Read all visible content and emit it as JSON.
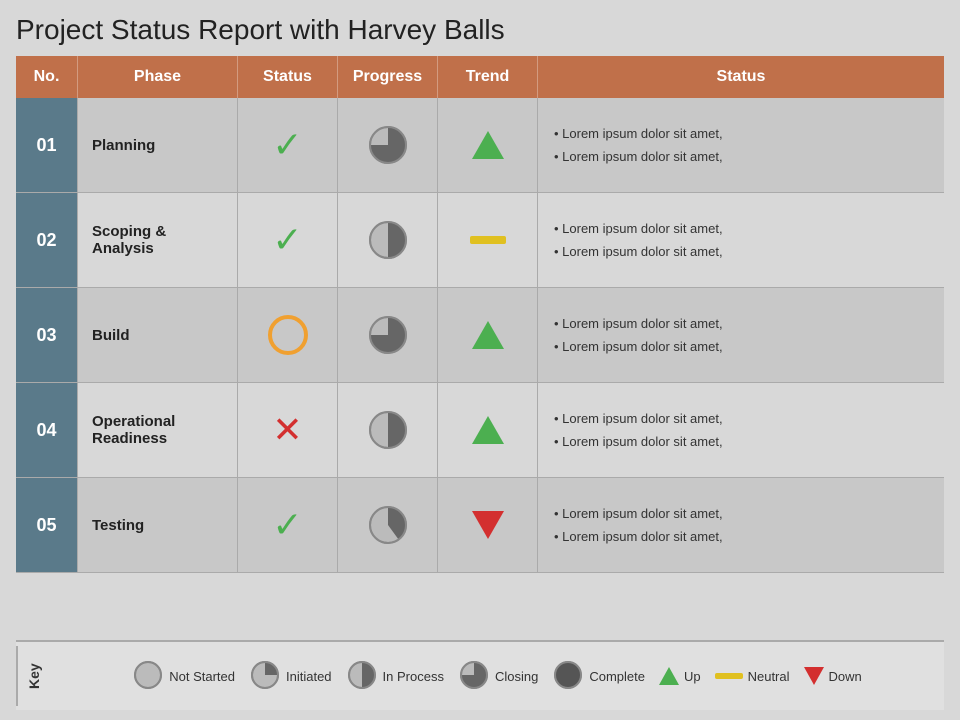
{
  "title": "Project Status Report with Harvey Balls",
  "header": {
    "col1": "No.",
    "col2": "Phase",
    "col3": "Status",
    "col4": "Progress",
    "col5": "Trend",
    "col6": "Status"
  },
  "rows": [
    {
      "no": "01",
      "phase": "Planning",
      "status_type": "check",
      "progress_fill": 0.75,
      "trend": "up",
      "status_lines": [
        "Lorem ipsum dolor sit amet,",
        "Lorem ipsum dolor sit amet,"
      ]
    },
    {
      "no": "02",
      "phase": "Scoping & Analysis",
      "status_type": "check",
      "progress_fill": 0.5,
      "trend": "neutral",
      "status_lines": [
        "Lorem ipsum dolor sit amet,",
        "Lorem ipsum dolor sit amet,"
      ]
    },
    {
      "no": "03",
      "phase": "Build",
      "status_type": "circle_orange",
      "progress_fill": 0.75,
      "trend": "up",
      "status_lines": [
        "Lorem ipsum dolor sit amet,",
        "Lorem ipsum dolor sit amet,"
      ]
    },
    {
      "no": "04",
      "phase": "Operational Readiness",
      "status_type": "cross",
      "progress_fill": 0.5,
      "trend": "up",
      "status_lines": [
        "Lorem ipsum dolor sit amet,",
        "Lorem ipsum dolor sit amet,"
      ]
    },
    {
      "no": "05",
      "phase": "Testing",
      "status_type": "check",
      "progress_fill": 0.4,
      "trend": "down",
      "status_lines": [
        "Lorem ipsum dolor sit amet,",
        "Lorem ipsum dolor sit amet,"
      ]
    }
  ],
  "legend": {
    "key_label": "Key",
    "items": [
      {
        "label": "Not Started",
        "type": "harvey",
        "fill": 0
      },
      {
        "label": "Initiated",
        "type": "harvey",
        "fill": 0.25
      },
      {
        "label": "In Process",
        "type": "harvey",
        "fill": 0.5
      },
      {
        "label": "Closing",
        "type": "harvey",
        "fill": 0.75
      },
      {
        "label": "Complete",
        "type": "harvey",
        "fill": 1
      },
      {
        "label": "Up",
        "type": "arrow_up"
      },
      {
        "label": "Neutral",
        "type": "neutral"
      },
      {
        "label": "Down",
        "type": "arrow_down"
      }
    ]
  }
}
